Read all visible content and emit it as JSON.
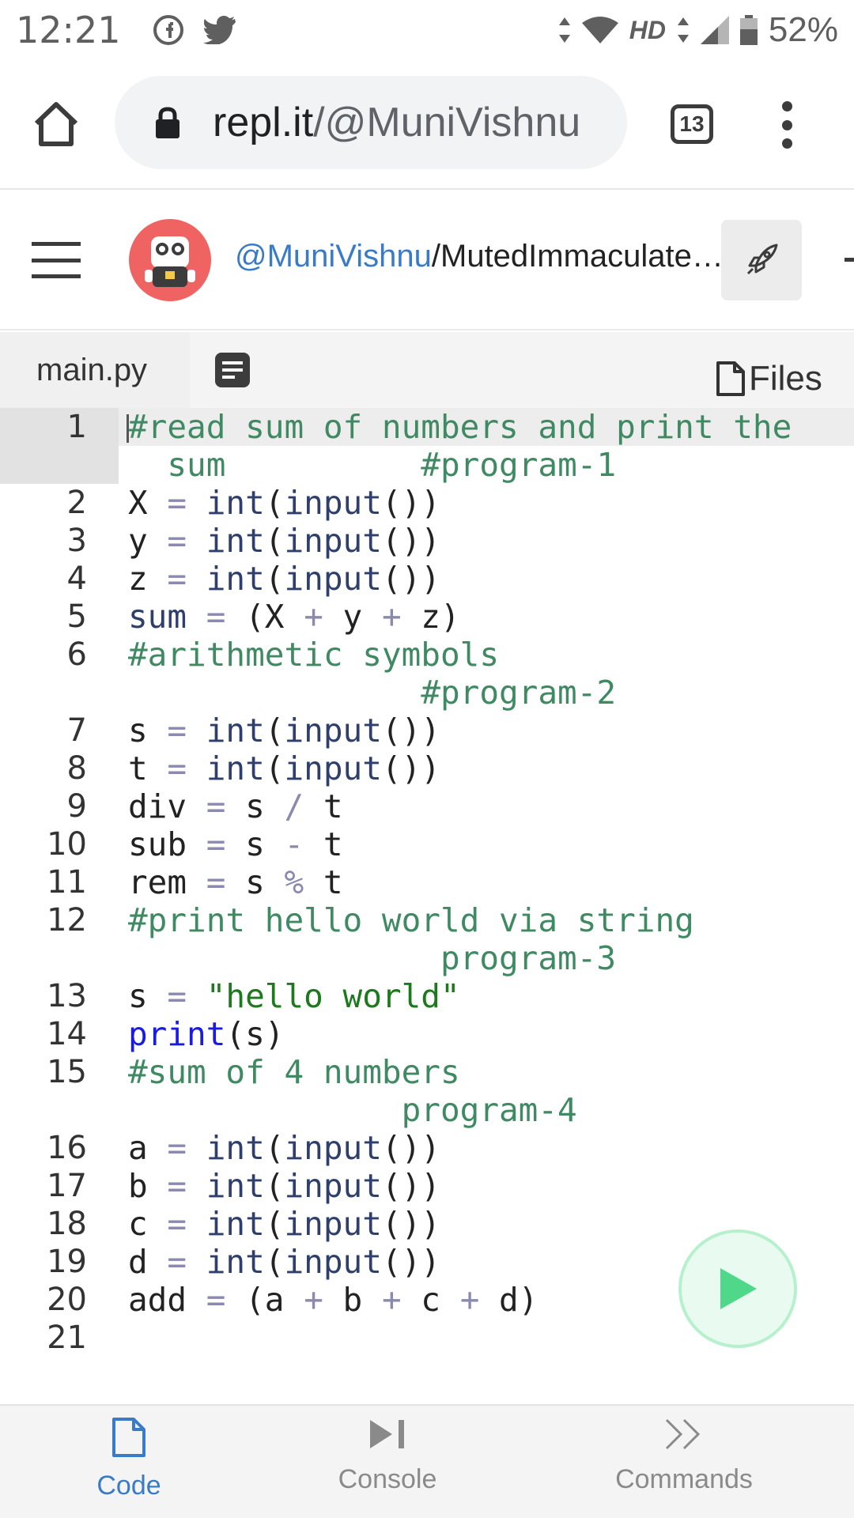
{
  "status_bar": {
    "time": "12:21",
    "hd": "HD",
    "battery": "52%"
  },
  "browser": {
    "url_host": "repl.it",
    "url_path": "/@MuniVishnu",
    "tab_count": "13"
  },
  "repl": {
    "user": "@MuniVishnu",
    "name": "/MutedImmaculate…"
  },
  "editor_tabs": {
    "file_tab": "main.py",
    "files_label": "Files"
  },
  "code_lines": [
    {
      "num": "1",
      "text": "#read sum of numbers and print the"
    },
    {
      "num": "",
      "text": "  sum          #program-1"
    },
    {
      "num": "2",
      "text": "X = int(input())"
    },
    {
      "num": "3",
      "text": "y = int(input())"
    },
    {
      "num": "4",
      "text": "z = int(input())"
    },
    {
      "num": "5",
      "text": "sum = (X + y + z)"
    },
    {
      "num": "6",
      "text": "#arithmetic symbols"
    },
    {
      "num": "",
      "text": "               #program-2"
    },
    {
      "num": "7",
      "text": "s = int(input())"
    },
    {
      "num": "8",
      "text": "t = int(input())"
    },
    {
      "num": "9",
      "text": "div = s / t"
    },
    {
      "num": "10",
      "text": "sub = s - t"
    },
    {
      "num": "11",
      "text": "rem = s % t"
    },
    {
      "num": "12",
      "text": "#print hello world via string"
    },
    {
      "num": "",
      "text": "                program-3"
    },
    {
      "num": "13",
      "text": "s = \"hello world\""
    },
    {
      "num": "14",
      "text": "print(s)"
    },
    {
      "num": "15",
      "text": "#sum of 4 numbers"
    },
    {
      "num": "",
      "text": "              program-4"
    },
    {
      "num": "16",
      "text": "a = int(input())"
    },
    {
      "num": "17",
      "text": "b = int(input())"
    },
    {
      "num": "18",
      "text": "c = int(input())"
    },
    {
      "num": "19",
      "text": "d = int(input())"
    },
    {
      "num": "20",
      "text": "add = (a + b + c + d)"
    },
    {
      "num": "21",
      "text": ""
    }
  ],
  "bottom_nav": {
    "code": "Code",
    "console": "Console",
    "commands": "Commands"
  },
  "colors": {
    "accent": "#3a7bc8",
    "comment": "#3f8a63",
    "keyword": "#1a1ae6",
    "string": "#1b7a1b",
    "run_button": "#b6f0cc"
  }
}
